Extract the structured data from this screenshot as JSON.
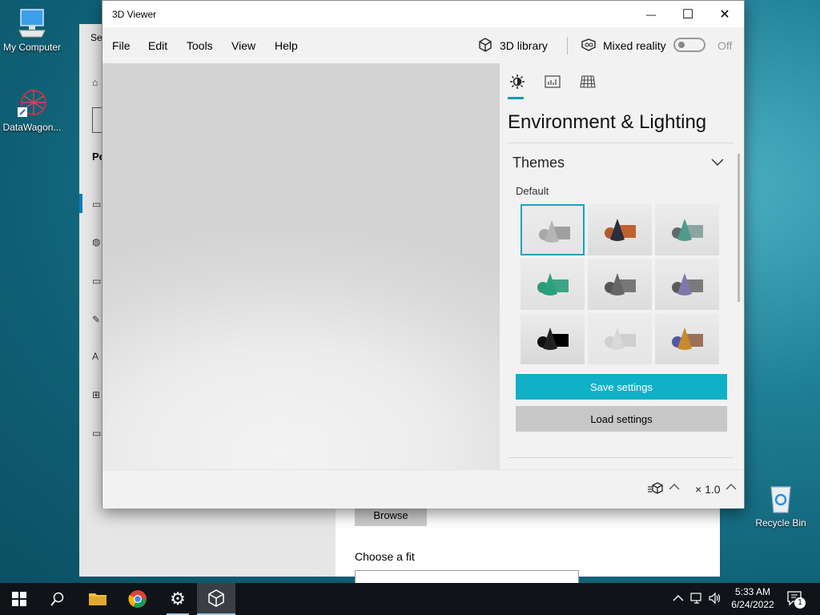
{
  "desktop": {
    "icons": [
      {
        "label": "My Computer",
        "icon": "computer-icon"
      },
      {
        "label": "DataWagon...",
        "icon": "datawagon-icon"
      },
      {
        "label": "Recycle Bin",
        "icon": "recycle-bin-icon"
      }
    ]
  },
  "settings_window": {
    "title": "Set",
    "section_fragment": "Pe",
    "browse_label": "Browse",
    "fit_label": "Choose a fit"
  },
  "viewer": {
    "title": "3D Viewer",
    "window_buttons": {
      "minimize": "—",
      "maximize": "☐",
      "close": "✕"
    },
    "menu": [
      "File",
      "Edit",
      "Tools",
      "View",
      "Help"
    ],
    "library_label": "3D library",
    "mixed_reality_label": "Mixed reality",
    "mixed_reality_state": "Off",
    "panel": {
      "tabs": [
        "environment-lighting-tab",
        "stats-tab",
        "grid-tab"
      ],
      "title": "Environment & Lighting",
      "section": "Themes",
      "subsection": "Default",
      "themes": [
        {
          "name": "default-gray",
          "colors": [
            "#a8a8a8",
            "#b5b5b5",
            "#9f9f9f"
          ],
          "bg": "#e4e4e4",
          "selected": true
        },
        {
          "name": "warm",
          "colors": [
            "#b3592f",
            "#2a2f3e",
            "#c0602e"
          ],
          "bg": "#dcdcdc",
          "selected": false
        },
        {
          "name": "teal-gray",
          "colors": [
            "#5f6a6a",
            "#4f9a8c",
            "#8aa5a0"
          ],
          "bg": "#dedede",
          "selected": false
        },
        {
          "name": "green",
          "colors": [
            "#2f9a78",
            "#2aa07e",
            "#3da486"
          ],
          "bg": "#e0e0e0",
          "selected": false
        },
        {
          "name": "dark-gray",
          "colors": [
            "#555",
            "#666",
            "#777"
          ],
          "bg": "#dcdcdc",
          "selected": false
        },
        {
          "name": "violet",
          "colors": [
            "#5a5a5a",
            "#8078a8",
            "#7a7a7a"
          ],
          "bg": "#dedede",
          "selected": false
        },
        {
          "name": "black",
          "colors": [
            "#111",
            "#222",
            "#000"
          ],
          "bg": "#d8d8d8",
          "selected": false
        },
        {
          "name": "light",
          "colors": [
            "#d0d0d0",
            "#d8d8d8",
            "#cfcfcf"
          ],
          "bg": "#e6e6e6",
          "selected": false
        },
        {
          "name": "multicolor",
          "colors": [
            "#4f58a0",
            "#c88a2e",
            "#9a7058"
          ],
          "bg": "#dcdcdc",
          "selected": false
        }
      ],
      "save_label": "Save settings",
      "load_label": "Load settings"
    },
    "status": {
      "zoom": "× 1.0"
    }
  },
  "taskbar": {
    "time": "5:33 AM",
    "date": "6/24/2022",
    "notifications": "1"
  },
  "colors": {
    "accent": "#10b0c7",
    "selected_border": "#12a6bf"
  }
}
